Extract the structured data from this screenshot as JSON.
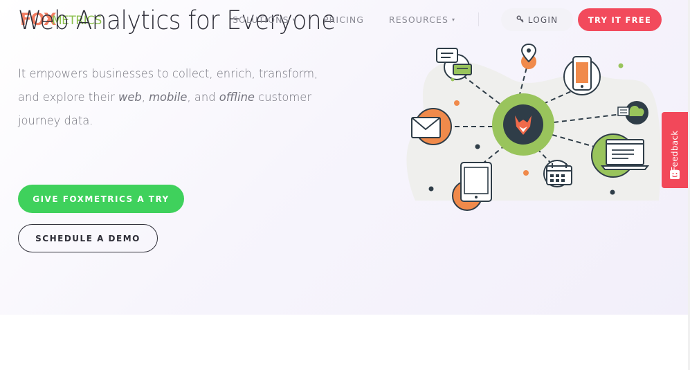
{
  "header": {
    "logo": {
      "part1": "FOX",
      "part2": "METRICS"
    },
    "nav": [
      {
        "label": "SOLUTIONS"
      },
      {
        "label": "PRICING"
      },
      {
        "label": "RESOURCES"
      }
    ],
    "login_label": "LOGIN",
    "try_label": "TRY IT FREE"
  },
  "hero": {
    "headline": "Web Analytics for Everyone",
    "sub_line1": "It empowers businesses to collect, enrich, transform,",
    "sub_line2_a": "and explore their ",
    "sub_web": "web",
    "sub_comma1": ", ",
    "sub_mobile": "mobile",
    "sub_comma2": ", and ",
    "sub_offline": "offline",
    "sub_line2_b": " customer",
    "sub_line3": "journey data.",
    "cta_primary": "GIVE FOXMETRICS A TRY",
    "cta_secondary": "SCHEDULE A DEMO"
  },
  "feedback": {
    "label": "Feedback"
  },
  "colors": {
    "accent_red": "#f24a5c",
    "accent_green": "#3fd15c",
    "brand_green": "#8cc04e",
    "brand_orange": "#f06a4a",
    "dark": "#2e2e38"
  }
}
